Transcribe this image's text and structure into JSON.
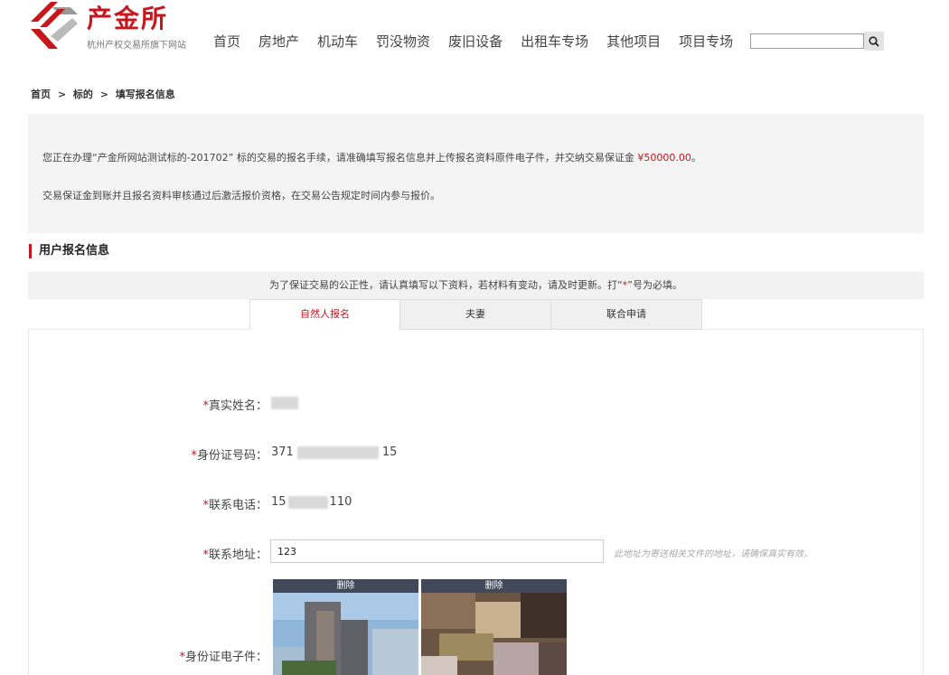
{
  "header": {
    "logo_name": "产金所",
    "logo_sub": "杭州产权交易所旗下网站",
    "nav": [
      "首页",
      "房地产",
      "机动车",
      "罚没物资",
      "废旧设备",
      "出租车专场",
      "其他项目",
      "项目专场"
    ],
    "search_placeholder": ""
  },
  "breadcrumb": [
    "首页",
    ">",
    "标的",
    ">",
    "填写报名信息"
  ],
  "notice": {
    "line1_prefix": "您正在办理“产金所网站测试标的-201702” 标的交易的报名手续，请准确填写报名信息并上传报名资料原件电子件，并交纳交易保证金 ",
    "amount": "¥50000.00",
    "line1_suffix": "。",
    "line2": "交易保证金到账并且报名资料审核通过后激活报价资格，在交易公告规定时间内参与报价。"
  },
  "section_title": "用户报名信息",
  "tip": {
    "prefix": "为了保证交易的公正性，请认真填写以下资料，若材料有变动，请及时更新。打“",
    "star": "*",
    "suffix": "”号为必填。"
  },
  "tabs": [
    "自然人报名",
    "夫妻",
    "联合申请"
  ],
  "form": {
    "required_mark": "*",
    "name_label": "真实姓名：",
    "id_label": "身份证号码：",
    "id_prefix": "371",
    "id_suffix": "15",
    "phone_label": "联系电话：",
    "phone_prefix": "15",
    "phone_suffix": "110",
    "address_label": "联系地址：",
    "address_value": "123",
    "address_hint": "此地址为寄送相关文件的地址，请确保真实有效。",
    "idcard_label": "身份证电子件：",
    "delete_label": "删除"
  },
  "colors": {
    "accent": "#c8161d"
  },
  "icons": {
    "search": "search-icon",
    "logo": "logo-mark-icon"
  }
}
